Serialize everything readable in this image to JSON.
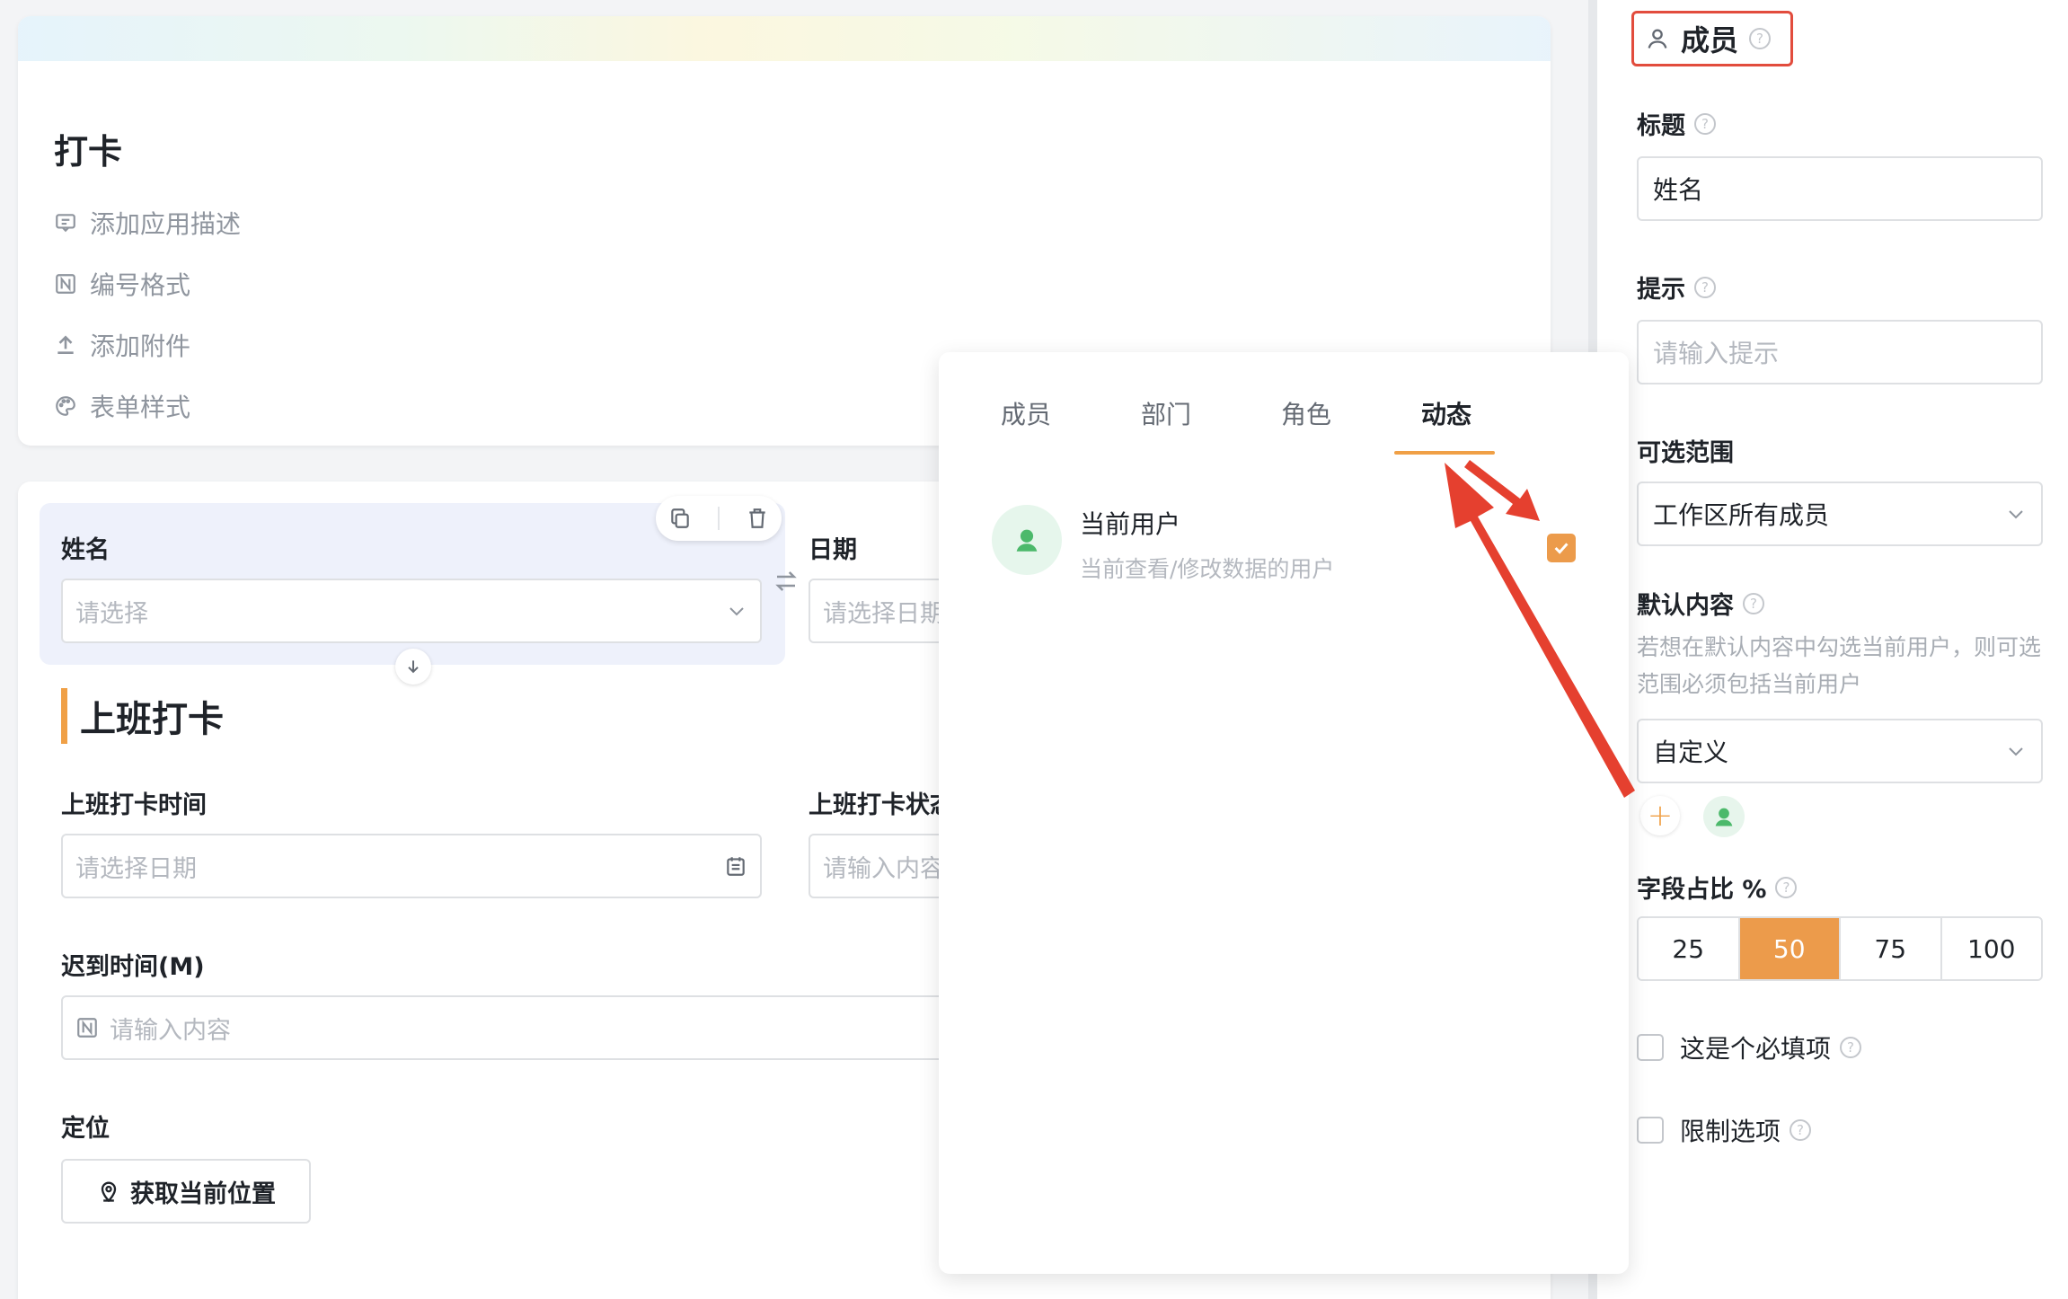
{
  "app": {
    "title": "打卡",
    "meta": [
      {
        "icon": "comment-icon",
        "label": "添加应用描述"
      },
      {
        "icon": "number-format-icon",
        "label": "编号格式"
      },
      {
        "icon": "upload-icon",
        "label": "添加附件"
      },
      {
        "icon": "palette-icon",
        "label": "表单样式"
      }
    ]
  },
  "form": {
    "name_label": "姓名",
    "name_placeholder": "请选择",
    "date_label": "日期",
    "date_placeholder": "请选择日期",
    "section_title": "上班打卡",
    "checkin_time_label": "上班打卡时间",
    "checkin_time_placeholder": "请选择日期",
    "checkin_status_label": "上班打卡状态",
    "checkin_status_placeholder": "请输入内容",
    "late_label": "迟到时间(M)",
    "late_placeholder": "请输入内容",
    "location_label": "定位",
    "location_button": "获取当前位置"
  },
  "popup": {
    "tabs": [
      "成员",
      "部门",
      "角色",
      "动态"
    ],
    "active_tab": "动态",
    "item_name": "当前用户",
    "item_desc": "当前查看/修改数据的用户",
    "item_checked": true
  },
  "panel": {
    "header": "成员",
    "title_label": "标题",
    "title_value": "姓名",
    "hint_label": "提示",
    "hint_placeholder": "请输入提示",
    "range_label": "可选范围",
    "range_value": "工作区所有成员",
    "default_label": "默认内容",
    "default_note": "若想在默认内容中勾选当前用户，则可选范围必须包括当前用户",
    "default_value": "自定义",
    "ratio_label": "字段占比 %",
    "ratio_options": [
      "25",
      "50",
      "75",
      "100"
    ],
    "ratio_selected": "50",
    "required_label": "这是个必填项",
    "limit_label": "限制选项"
  },
  "colors": {
    "accent": "#ec9b4b",
    "highlight_box": "#e24c3d",
    "arrow": "#e5402f",
    "avatar_green": "#4cb96b"
  }
}
